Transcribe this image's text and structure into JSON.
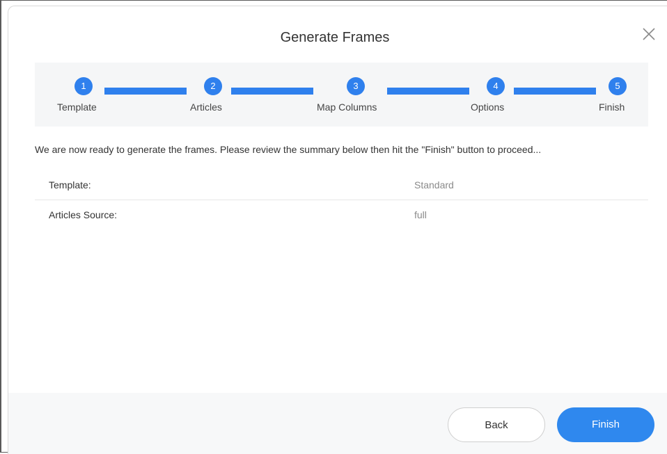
{
  "dialog": {
    "title": "Generate Frames",
    "close_icon": "close-icon"
  },
  "stepper": {
    "steps": [
      {
        "number": "1",
        "label": "Template"
      },
      {
        "number": "2",
        "label": "Articles"
      },
      {
        "number": "3",
        "label": "Map Columns"
      },
      {
        "number": "4",
        "label": "Options"
      },
      {
        "number": "5",
        "label": "Finish"
      }
    ],
    "active_color": "#2f80ed",
    "completed_steps": 5
  },
  "intro_text": "We are now ready to generate the frames. Please review the summary below then hit the \"Finish\" button to proceed...",
  "summary": [
    {
      "key": "Template:",
      "value": "Standard"
    },
    {
      "key": "Articles Source:",
      "value": "full"
    }
  ],
  "footer": {
    "back_label": "Back",
    "finish_label": "Finish",
    "finish_color": "#2f88ee"
  }
}
